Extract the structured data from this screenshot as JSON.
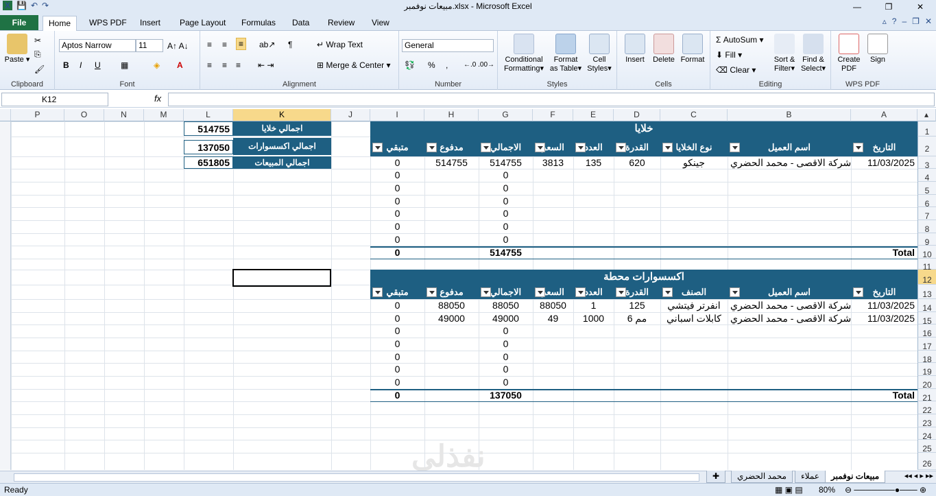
{
  "window": {
    "title": "مبيعات نوفمبر.xlsx  -  Microsoft Excel"
  },
  "tabs": [
    "File",
    "Home",
    "WPS PDF",
    "Insert",
    "Page Layout",
    "Formulas",
    "Data",
    "Review",
    "View"
  ],
  "ribbon": {
    "clipboard": {
      "label": "Clipboard",
      "paste": "Paste"
    },
    "font": {
      "label": "Font",
      "name": "Aptos Narrow",
      "size": "11"
    },
    "alignment": {
      "label": "Alignment",
      "wrap": "Wrap Text",
      "merge": "Merge & Center"
    },
    "number": {
      "label": "Number",
      "format": "General"
    },
    "styles": {
      "label": "Styles",
      "cond": "Conditional",
      "cond2": "Formatting",
      "fmt": "Format",
      "fmt2": "as Table",
      "cell": "Cell",
      "cell2": "Styles"
    },
    "cells": {
      "label": "Cells",
      "insert": "Insert",
      "delete": "Delete",
      "format": "Format"
    },
    "editing": {
      "label": "Editing",
      "autosum": "AutoSum",
      "fill": "Fill",
      "clear": "Clear",
      "sort": "Sort &",
      "sort2": "Filter",
      "find": "Find &",
      "find2": "Select"
    },
    "wps": {
      "label": "WPS PDF",
      "create": "Create",
      "create2": "PDF",
      "sign": "Sign"
    }
  },
  "formula_bar": {
    "name_box": "K12",
    "fx": "fx",
    "content": ""
  },
  "columns": [
    "P",
    "O",
    "N",
    "M",
    "L",
    "K",
    "J",
    "I",
    "H",
    "G",
    "F",
    "E",
    "D",
    "C",
    "B",
    "A"
  ],
  "rows": [
    "1",
    "2",
    "3",
    "4",
    "5",
    "6",
    "7",
    "8",
    "9",
    "10",
    "11",
    "12",
    "13",
    "14",
    "15",
    "16",
    "17",
    "18",
    "19",
    "20",
    "21",
    "22",
    "23",
    "24",
    "25",
    "26"
  ],
  "summary": [
    {
      "label": "اجمالي خلايا",
      "value": "514755"
    },
    {
      "label": "اجمالي اكسسوارات",
      "value": "137050"
    },
    {
      "label": "اجمالي المبيعات",
      "value": "651805"
    }
  ],
  "table1": {
    "title": "خلايا",
    "headers": [
      "متبقي",
      "مدفوع",
      "الاجمالي",
      "السعر",
      "العدد",
      "القدرة",
      "نوع الخلايا",
      "اسم العميل",
      "التاريخ"
    ],
    "row": [
      "0",
      "514755",
      "514755",
      "3813",
      "135",
      "620",
      "جينكو",
      "شركة الاقصى - محمد الحضري",
      "11/03/2025"
    ],
    "zeros": [
      "0",
      "0",
      "0",
      "0",
      "0",
      "0"
    ],
    "total_label": "Total",
    "total_remaining": "0",
    "total_sum": "514755"
  },
  "table2": {
    "title": "اكسسوارات محطة",
    "headers": [
      "متبقي",
      "مدفوع",
      "الاجمالي",
      "السعر",
      "العدد",
      "القدرة",
      "الصنف",
      "اسم العميل",
      "التاريخ"
    ],
    "rows": [
      [
        "0",
        "88050",
        "88050",
        "88050",
        "1",
        "125",
        "انفرتر فيتشي",
        "شركة الاقصى - محمد الحضري",
        "11/03/2025"
      ],
      [
        "0",
        "49000",
        "49000",
        "49",
        "1000",
        "6 مم",
        "كابلات اسباني",
        "شركة الاقصى - محمد الحضري",
        "11/03/2025"
      ]
    ],
    "zeros": [
      "0",
      "0",
      "0",
      "0",
      "0"
    ],
    "total_label": "Total",
    "total_remaining": "0",
    "total_sum": "137050"
  },
  "sheets": [
    "مبيعات نوفمبر",
    "عملاء",
    "محمد الحضري"
  ],
  "status": {
    "ready": "Ready",
    "zoom": "80%"
  },
  "watermark": "نفذلي"
}
